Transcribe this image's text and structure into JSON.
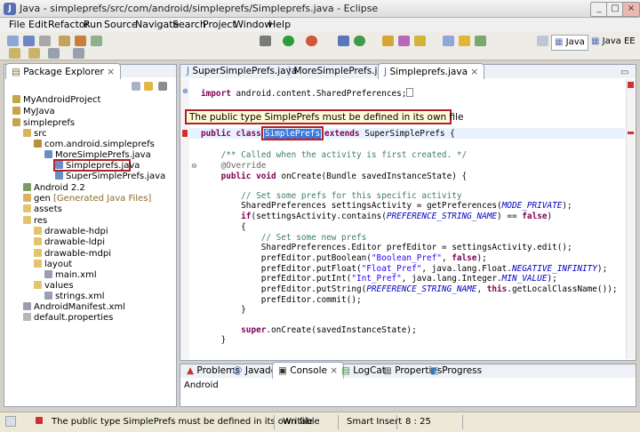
{
  "window": {
    "title": "Java - simpleprefs/src/com/android/simpleprefs/Simpleprefs.java - Eclipse"
  },
  "menu": [
    "File",
    "Edit",
    "Refactor",
    "Run",
    "Source",
    "Navigate",
    "Search",
    "Project",
    "Window",
    "Help"
  ],
  "perspectives": {
    "java": "Java",
    "java_ee": "Java EE"
  },
  "package_explorer": {
    "title": "Package Explorer",
    "items": [
      "MyAndroidProject",
      "MyJava",
      "simpleprefs",
      "src",
      "com.android.simpleprefs",
      "MoreSimplePrefs.java",
      "Simpleprefs.java",
      "SuperSimplePrefs.java",
      "Android 2.2",
      "gen",
      "[Generated Java Files]",
      "assets",
      "res",
      "drawable-hdpi",
      "drawable-ldpi",
      "drawable-mdpi",
      "layout",
      "main.xml",
      "values",
      "strings.xml",
      "AndroidManifest.xml",
      "default.properties"
    ]
  },
  "editor": {
    "tabs": [
      "SuperSimplePrefs.java",
      "MoreSimplePrefs.java",
      "Simpleprefs.java"
    ],
    "error_tooltip": "The public type SimplePrefs must be defined in its own file",
    "highlighted_word": "SimplePrefs"
  },
  "bottom_panel": {
    "tabs": [
      "Problems",
      "Javadoc",
      "Console",
      "LogCat",
      "Properties",
      "Progress"
    ],
    "console_label": "Android"
  },
  "status_bar": {
    "message": "The public type SimplePrefs must be defined in its own file",
    "writable": "Writable",
    "insert_mode": "Smart Insert",
    "position": "8 : 25"
  }
}
